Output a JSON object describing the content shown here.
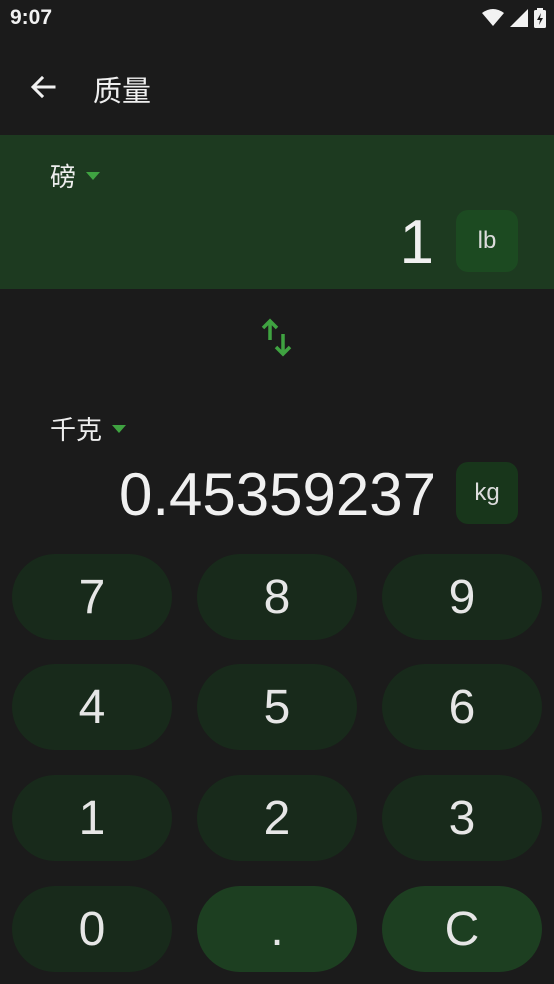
{
  "status_bar": {
    "time": "9:07"
  },
  "app_bar": {
    "title": "质量"
  },
  "from": {
    "unit_name": "磅",
    "value": "1",
    "symbol": "lb"
  },
  "to": {
    "unit_name": "千克",
    "value": "0.45359237",
    "symbol": "kg"
  },
  "keypad": {
    "keys": [
      "7",
      "8",
      "9",
      "4",
      "5",
      "6",
      "1",
      "2",
      "3",
      "0",
      ".",
      "C"
    ]
  },
  "colors": {
    "accent": "#3fa341",
    "panel": "#1d3a20",
    "background": "#1b1b1b"
  },
  "icons": {
    "back": "arrow-left-icon",
    "swap": "swap-vertical-icon"
  }
}
